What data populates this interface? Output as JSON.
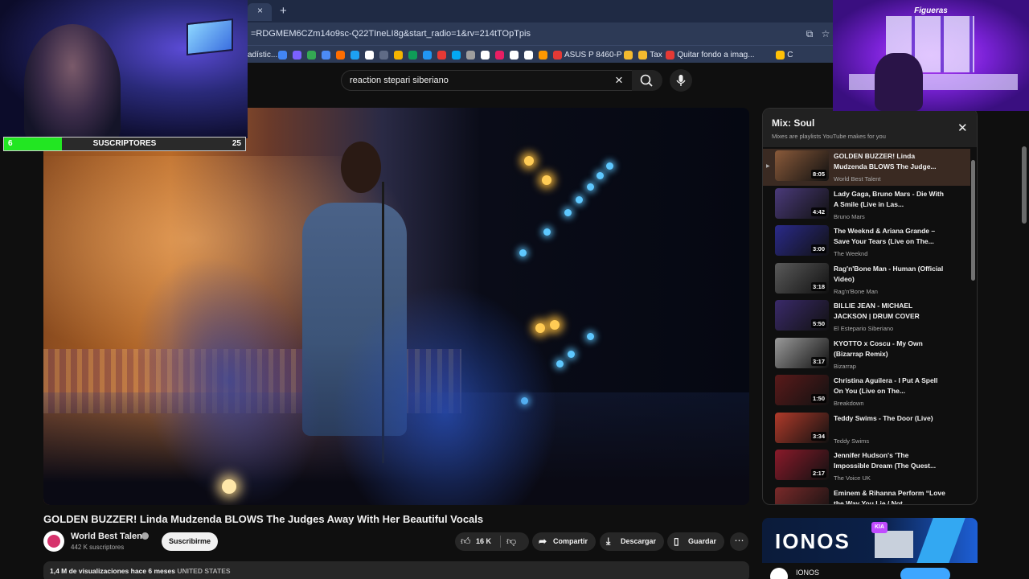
{
  "browser": {
    "tab_fragment": "",
    "url": "=RDGMEM6CZm14o9sc-Q22TIneLI8g&start_radio=1&rv=214tTOpTpis",
    "bookmarks": [
      {
        "label": "adístic...",
        "color": "#5f6b86"
      },
      {
        "label": "",
        "color": "#4285f4"
      },
      {
        "label": "",
        "color": "#7b61ff"
      },
      {
        "label": "",
        "color": "#34a853"
      },
      {
        "label": "",
        "color": "#4c8bf5"
      },
      {
        "label": "",
        "color": "#ff6d00"
      },
      {
        "label": "",
        "color": "#1da1f2"
      },
      {
        "label": "",
        "color": "#ffffff"
      },
      {
        "label": "",
        "color": "#5f6b86"
      },
      {
        "label": "",
        "color": "#f4b400"
      },
      {
        "label": "",
        "color": "#0f9d58"
      },
      {
        "label": "",
        "color": "#2196f3"
      },
      {
        "label": "",
        "color": "#e53935"
      },
      {
        "label": "",
        "color": "#03a9f4"
      },
      {
        "label": "",
        "color": "#9e9e9e"
      },
      {
        "label": "",
        "color": "#ffffff"
      },
      {
        "label": "",
        "color": "#e91e63"
      },
      {
        "label": "",
        "color": "#ffffff"
      },
      {
        "label": "",
        "color": "#ffffff"
      },
      {
        "label": "",
        "color": "#ff9800"
      },
      {
        "label": "ASUS P 8460-P",
        "color": "#e53935"
      },
      {
        "label": "",
        "color": "#f3ba2f"
      },
      {
        "label": "Tax",
        "color": "#f3ba2f"
      },
      {
        "label": "Quitar fondo a imag...",
        "color": "#e53935"
      },
      {
        "label": "C",
        "color": "#ffc107"
      }
    ]
  },
  "webcam_left": {
    "subs_count": "6",
    "subs_label": "SUSCRIPTORES",
    "subs_goal": "25",
    "subs_progress": 0.24
  },
  "webcam_right": {
    "logo_text": "Figueras"
  },
  "search": {
    "query": "reaction stepari siberiano"
  },
  "video": {
    "title": "GOLDEN BUZZER! Linda Mudzenda BLOWS The Judges Away With Her Beautiful Vocals",
    "channel": "World Best Talent",
    "subscribers": "442 K suscriptores",
    "subscribe_label": "Suscribirme",
    "likes": "16 K",
    "share_label": "Compartir",
    "download_label": "Descargar",
    "save_label": "Guardar",
    "views": "1,4 M de visualizaciones",
    "age": "hace 6 meses",
    "country": "UNITED STATES"
  },
  "playlist": {
    "title": "Mix: Soul",
    "subtitle": "Mixes are playlists YouTube makes for you",
    "items": [
      {
        "title": "GOLDEN BUZZER! Linda Mudzenda BLOWS The Judge...",
        "channel": "World Best Talent",
        "duration": "8:05",
        "thumb": "#8a5a3a",
        "active": true
      },
      {
        "title": "Lady Gaga, Bruno Mars - Die With A Smile (Live in Las...",
        "channel": "Bruno Mars",
        "duration": "4:42",
        "thumb": "#4a3a7a",
        "active": false
      },
      {
        "title": "The Weeknd & Ariana Grande – Save Your Tears (Live on The...",
        "channel": "The Weeknd",
        "duration": "3:00",
        "thumb": "#2a2a8a",
        "active": false
      },
      {
        "title": "Rag'n'Bone Man - Human (Official Video)",
        "channel": "Rag'n'Bone Man",
        "duration": "3:18",
        "thumb": "#5a5a5a",
        "active": false
      },
      {
        "title": "BILLIE JEAN - MICHAEL JACKSON | DRUM COVER",
        "channel": "El Estepario Siberiano",
        "duration": "5:50",
        "thumb": "#3a2a6a",
        "active": false
      },
      {
        "title": "KYOTTO x Coscu - My Own (Bizarrap Remix)",
        "channel": "Bizarrap",
        "duration": "3:17",
        "thumb": "#9a9a9a",
        "active": false
      },
      {
        "title": "Christina Aguilera - I Put A Spell On You (Live on The...",
        "channel": "Breakdown",
        "duration": "1:50",
        "thumb": "#5a1a1a",
        "active": false
      },
      {
        "title": "Teddy Swims - The Door (Live)",
        "channel": "Teddy Swims",
        "duration": "3:34",
        "thumb": "#b03a2a",
        "active": false
      },
      {
        "title": "Jennifer Hudson's 'The Impossible Dream (The Quest...",
        "channel": "The Voice UK",
        "duration": "2:17",
        "thumb": "#8a1a2a",
        "active": false
      },
      {
        "title": "Eminem & Rihanna Perform “Love the Way You Lie / Not...",
        "channel": "",
        "duration": "",
        "thumb": "#7a2a2a",
        "active": false
      }
    ]
  },
  "ad": {
    "brand": "IONOS",
    "badge": "KIA",
    "cta": ""
  },
  "icons": {
    "clear": "close-icon",
    "search": "search-icon",
    "mic": "mic-icon",
    "like": "thumb-up-icon",
    "dislike": "thumb-down-icon",
    "share": "share-icon",
    "download": "download-icon",
    "save": "bookmark-icon",
    "more": "more-icon"
  }
}
